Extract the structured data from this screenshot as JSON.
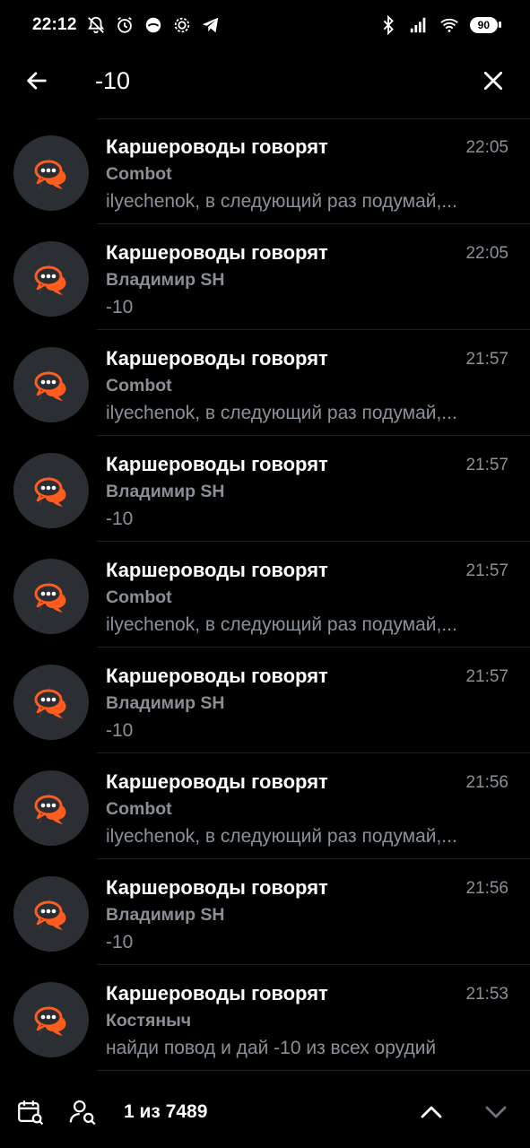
{
  "status_bar": {
    "time": "22:12",
    "battery": "90",
    "icons": [
      "mute-bell-icon",
      "alarm-icon",
      "app-icon",
      "settings-app-icon",
      "telegram-icon",
      "bluetooth-icon",
      "signal-icon",
      "wifi-icon"
    ]
  },
  "search": {
    "query": "-10"
  },
  "results": [
    {
      "title": "Каршероводы говорят",
      "time": "22:05",
      "sender": "Combot",
      "text": "ilyechenok, в следующий раз подумай,..."
    },
    {
      "title": "Каршероводы говорят",
      "time": "22:05",
      "sender": "Владимир SH",
      "text": "-10"
    },
    {
      "title": "Каршероводы говорят",
      "time": "21:57",
      "sender": "Combot",
      "text": "ilyechenok, в следующий раз подумай,..."
    },
    {
      "title": "Каршероводы говорят",
      "time": "21:57",
      "sender": "Владимир SH",
      "text": "-10"
    },
    {
      "title": "Каршероводы говорят",
      "time": "21:57",
      "sender": "Combot",
      "text": "ilyechenok, в следующий раз подумай,..."
    },
    {
      "title": "Каршероводы говорят",
      "time": "21:57",
      "sender": "Владимир SH",
      "text": "-10"
    },
    {
      "title": "Каршероводы говорят",
      "time": "21:56",
      "sender": "Combot",
      "text": "ilyechenok, в следующий раз подумай,..."
    },
    {
      "title": "Каршероводы говорят",
      "time": "21:56",
      "sender": "Владимир SH",
      "text": "-10"
    },
    {
      "title": "Каршероводы говорят",
      "time": "21:53",
      "sender": "Костяныч",
      "text": "найди повод и дай -10 из всех орудий"
    }
  ],
  "bottom_bar": {
    "counter": "1 из 7489"
  },
  "colors": {
    "background": "#000000",
    "avatar_bg": "#2b2e33",
    "avatar_accent": "#ff5c1f",
    "secondary_text": "#8b9199"
  }
}
